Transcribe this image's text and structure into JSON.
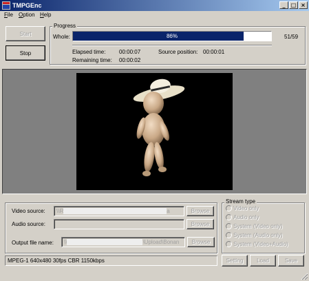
{
  "window": {
    "title": "TMPGEnc",
    "controls": {
      "minimize": "_",
      "maximize": "□",
      "close": "×"
    }
  },
  "menu": [
    {
      "accel": "F",
      "rest": "ile"
    },
    {
      "accel": "O",
      "rest": "ption"
    },
    {
      "accel": "H",
      "rest": "elp"
    }
  ],
  "buttons": {
    "start": "Start",
    "stop": "Stop"
  },
  "progress": {
    "group_title": "Progress",
    "whole_label": "Whole:",
    "percent_text": "86%",
    "fraction": 0.86,
    "count": "51/59",
    "elapsed_label": "Elapsed time:",
    "elapsed_value": "00:00:07",
    "remaining_label": "Remaining time:",
    "remaining_value": "00:00:02",
    "source_pos_label": "Source position:",
    "source_pos_value": "00:00:01"
  },
  "sources": {
    "video_label": "Video source:",
    "video_value_prefix": "\\\\R",
    "video_value_suffix": "a",
    "audio_label": "Audio source:",
    "output_label": "Output file name:",
    "output_value_prefix": "\\\\",
    "output_value_suffix": "\\Upload\\Bonan",
    "browse_label": "Browse"
  },
  "stream_type": {
    "group_title": "Stream type",
    "options": [
      "Video only",
      "Audio only",
      "System (Video only)",
      "System (Audio only)",
      "System (Video+Audio)"
    ]
  },
  "status_text": "MPEG-1 640x480 30fps CBR 1150kbps",
  "footer_buttons": {
    "setting": "Setting",
    "load": "Load",
    "save": "Save"
  },
  "colors": {
    "titlebar_start": "#0a246a",
    "progress_fill": "#0a246a",
    "face": "#d4d0c8"
  },
  "icons": [
    "app-icon",
    "minimize-icon",
    "maximize-icon",
    "close-icon"
  ]
}
